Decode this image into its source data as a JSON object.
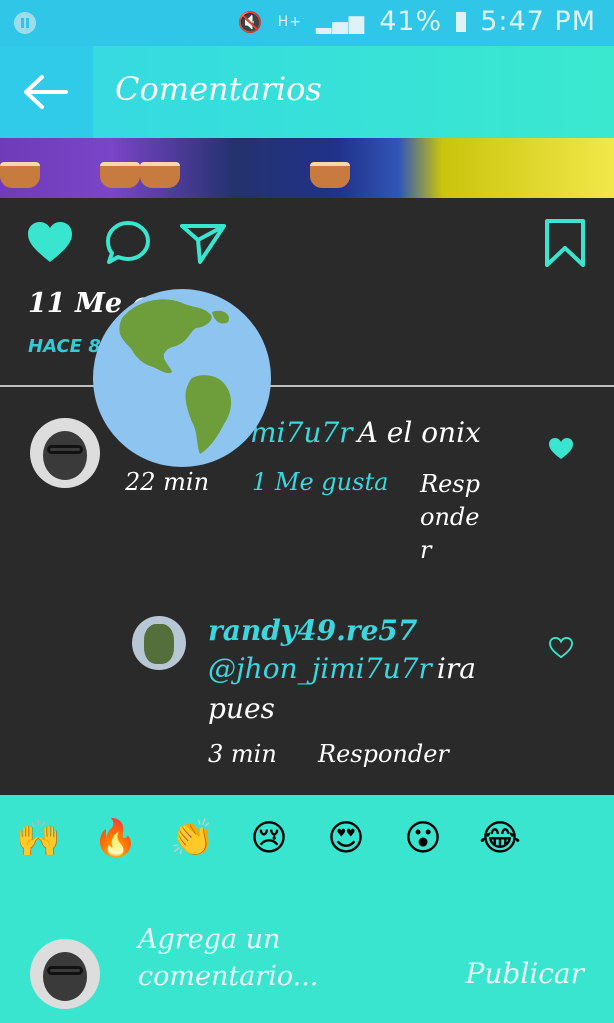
{
  "status_bar": {
    "battery": "41%",
    "time": "5:47 PM",
    "network": "H+"
  },
  "header": {
    "title": "Comentarios"
  },
  "post": {
    "likes": "11 Me g",
    "time_ago": "HACE 8"
  },
  "comments": [
    {
      "user_partial": "mi7u7r",
      "text": "A el onix",
      "time": "22 min",
      "likes": "1 Me gusta",
      "reply": "Resp\nonde\nr",
      "reply_lines": [
        "Resp",
        "onde",
        "r"
      ],
      "liked": true
    }
  ],
  "replies": [
    {
      "user": "randy49.re57",
      "mention": "@jhon_jimi7u7r",
      "text_suffix": "ira",
      "text_line2": "pues",
      "time": "3 min",
      "reply": "Responder",
      "liked": false
    }
  ],
  "emojis": [
    "🙌",
    "🔥",
    "👏",
    "😢",
    "😍",
    "😮",
    "😂"
  ],
  "composer": {
    "placeholder_line1": "Agrega un",
    "placeholder_line2": "comentario...",
    "publish_label": "Publicar"
  },
  "colors": {
    "accent": "#39e5cf",
    "status_bar": "#2fc6e8",
    "background": "#2a2a2a",
    "link": "#3ad7df"
  }
}
